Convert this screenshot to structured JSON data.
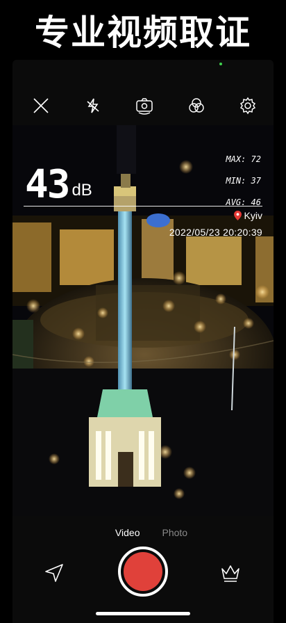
{
  "banner": {
    "headline": "专业视频取证"
  },
  "toolbar": {
    "icons": [
      "close-icon",
      "flash-off-icon",
      "camera-flip-icon",
      "color-filter-icon",
      "settings-icon"
    ]
  },
  "meter": {
    "db_value": "43",
    "db_unit": "dB",
    "max_label": "MAX: 72",
    "min_label": "MIN: 37",
    "avg_label": "AVG: 46"
  },
  "location": {
    "city": "Kyiv",
    "timestamp": "2022/05/23 20:20:39"
  },
  "modes": {
    "video": "Video",
    "photo": "Photo",
    "selected": "Video"
  },
  "bottom": {
    "left_icon": "navigation-arrow-icon",
    "right_icon": "crown-icon"
  },
  "colors": {
    "record": "#e0413a",
    "pin": "#e53935",
    "status_dot": "#3fd14e"
  }
}
